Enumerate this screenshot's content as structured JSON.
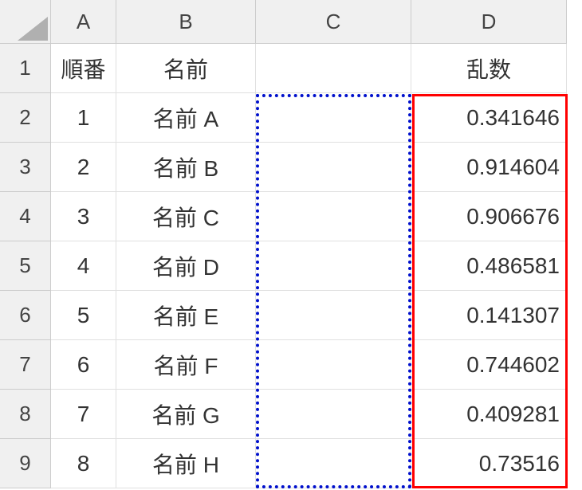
{
  "columnHeaders": [
    "A",
    "B",
    "C",
    "D"
  ],
  "rowHeaders": [
    "1",
    "2",
    "3",
    "4",
    "5",
    "6",
    "7",
    "8",
    "9"
  ],
  "headerRow": {
    "A": "順番",
    "B": "名前",
    "C": "",
    "D": "乱数"
  },
  "rows": [
    {
      "A": "1",
      "B": "名前 A",
      "C": "",
      "D": "0.341646"
    },
    {
      "A": "2",
      "B": "名前 B",
      "C": "",
      "D": "0.914604"
    },
    {
      "A": "3",
      "B": "名前 C",
      "C": "",
      "D": "0.906676"
    },
    {
      "A": "4",
      "B": "名前 D",
      "C": "",
      "D": "0.486581"
    },
    {
      "A": "5",
      "B": "名前 E",
      "C": "",
      "D": "0.141307"
    },
    {
      "A": "6",
      "B": "名前 F",
      "C": "",
      "D": "0.744602"
    },
    {
      "A": "7",
      "B": "名前 G",
      "C": "",
      "D": "0.409281"
    },
    {
      "A": "8",
      "B": "名前 H",
      "C": "",
      "D": "0.73516"
    }
  ],
  "overlays": {
    "blueDotted": {
      "col": "C",
      "startRow": 2,
      "endRow": 9
    },
    "redSolid": {
      "col": "D",
      "startRow": 2,
      "endRow": 9
    }
  },
  "chart_data": {
    "type": "table",
    "title": "",
    "columns": [
      "順番",
      "名前",
      "乱数"
    ],
    "data": [
      {
        "順番": 1,
        "名前": "名前 A",
        "乱数": 0.341646
      },
      {
        "順番": 2,
        "名前": "名前 B",
        "乱数": 0.914604
      },
      {
        "順番": 3,
        "名前": "名前 C",
        "乱数": 0.906676
      },
      {
        "順番": 4,
        "名前": "名前 D",
        "乱数": 0.486581
      },
      {
        "順番": 5,
        "名前": "名前 E",
        "乱数": 0.141307
      },
      {
        "順番": 6,
        "名前": "名前 F",
        "乱数": 0.744602
      },
      {
        "順番": 7,
        "名前": "名前 G",
        "乱数": 0.409281
      },
      {
        "順番": 8,
        "名前": "名前 H",
        "乱数": 0.73516
      }
    ]
  }
}
